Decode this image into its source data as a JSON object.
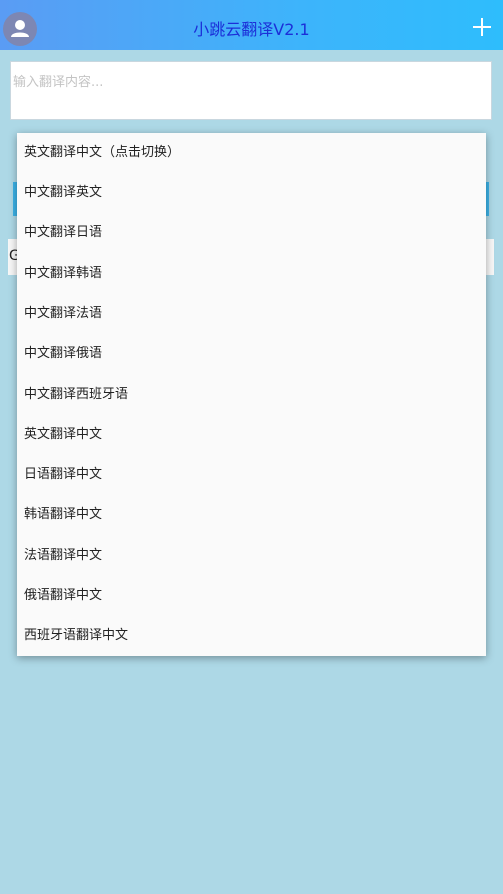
{
  "header": {
    "title": "小跳云翻译V2.1",
    "avatar_icon": "user-icon",
    "add_icon": "plus-icon"
  },
  "input": {
    "placeholder": "输入翻译内容...",
    "value": ""
  },
  "result": {
    "text": "G"
  },
  "dropdown": {
    "items": [
      "英文翻译中文（点击切换）",
      "中文翻译英文",
      "中文翻译日语",
      "中文翻译韩语",
      "中文翻译法语",
      "中文翻译俄语",
      "中文翻译西班牙语",
      "英文翻译中文",
      "日语翻译中文",
      "韩语翻译中文",
      "法语翻译中文",
      "俄语翻译中文",
      "西班牙语翻译中文"
    ]
  },
  "colors": {
    "background": "#add8e6",
    "title": "#1c2fd8",
    "accent": "#3bb3e8"
  }
}
